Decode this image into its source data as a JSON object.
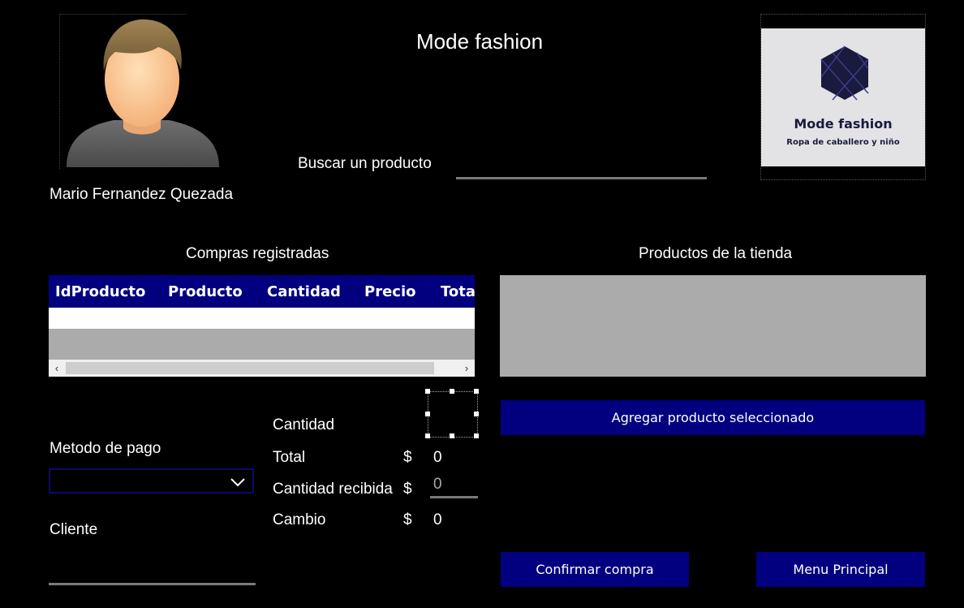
{
  "app": {
    "title": "Mode fashion",
    "user_name": "Mario Fernandez Quezada"
  },
  "logo": {
    "brand": "Mode fashion",
    "tagline": "Ropa de caballero y niño"
  },
  "search": {
    "label": "Buscar un producto",
    "value": ""
  },
  "purchases": {
    "title": "Compras registradas",
    "columns": [
      "IdProducto",
      "Producto",
      "Cantidad",
      "Precio",
      "Total"
    ]
  },
  "products": {
    "title": "Productos de la tienda"
  },
  "buttons": {
    "add_selected": "Agregar producto seleccionado",
    "confirm": "Confirmar compra",
    "main_menu": "Menu Principal"
  },
  "payment": {
    "label": "Metodo de pago",
    "selected": ""
  },
  "client": {
    "label": "Cliente",
    "value": ""
  },
  "summary": {
    "quantity_label": "Cantidad",
    "total_label": "Total",
    "total_currency": "$",
    "total_value": "0",
    "received_label": "Cantidad recibida",
    "received_currency": "$",
    "received_placeholder": "0",
    "change_label": "Cambio",
    "change_currency": "$",
    "change_value": "0"
  },
  "colors": {
    "background": "#000000",
    "accent": "#02007e",
    "grid_body": "#ababab"
  }
}
